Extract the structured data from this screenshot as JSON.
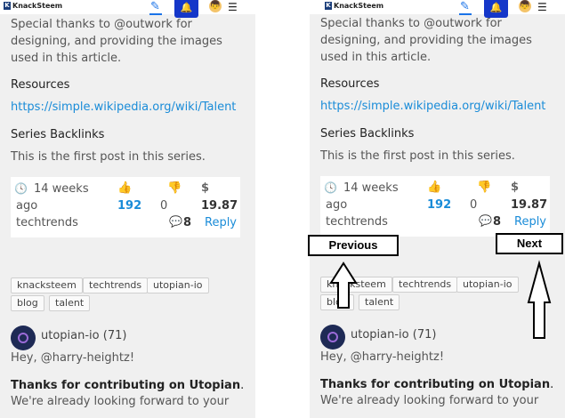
{
  "header": {
    "logo_text": "KnackSteem",
    "logo_mark": "K",
    "pencil_glyph": "✎",
    "bell_glyph": "🔔",
    "avatar_glyph": "👦",
    "menu_glyph": "☰"
  },
  "article": {
    "thanks_text": "Special thanks to @outwork for",
    "line2": "designing, and providing the images",
    "line3": "used in this article.",
    "resources_heading": "Resources",
    "resources_link": "https://simple.wikipedia.org/wiki/Talent",
    "backlinks_heading": "Series Backlinks",
    "backlinks_text": "This is the first post in this series."
  },
  "post_card": {
    "time_icon": "🕓",
    "time_value": "14 weeks",
    "time_suffix": "ago",
    "category": "techtrends",
    "like_icon": "👍",
    "likes": "192",
    "dislike_icon": "👎",
    "dislikes": "0",
    "dollar": "$",
    "payout": "19.87",
    "comment_icon": "💬",
    "comments": "8",
    "reply": "Reply"
  },
  "tags": [
    "knacksteem",
    "techtrends",
    "utopian-io",
    "blog",
    "talent"
  ],
  "comment": {
    "author": "utopian-io (71)",
    "greeting": "Hey, @harry-heightz!",
    "bold_text": "Thanks for contributing on Utopian",
    "bold_suffix": ".",
    "next_line": "We're already looking forward to your"
  },
  "annotations": {
    "previous": "Previous",
    "next": "Next"
  },
  "colors": {
    "link": "#1a8cd8",
    "accent_blue": "#1537c9",
    "panel_bg": "#f0f0f0"
  }
}
